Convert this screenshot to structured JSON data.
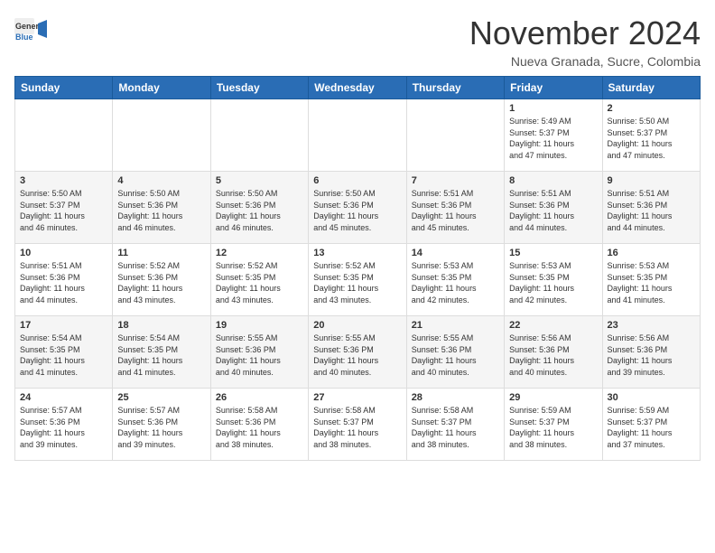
{
  "header": {
    "logo_line1": "General",
    "logo_line2": "Blue",
    "month": "November 2024",
    "location": "Nueva Granada, Sucre, Colombia"
  },
  "weekdays": [
    "Sunday",
    "Monday",
    "Tuesday",
    "Wednesday",
    "Thursday",
    "Friday",
    "Saturday"
  ],
  "weeks": [
    [
      {
        "day": "",
        "info": ""
      },
      {
        "day": "",
        "info": ""
      },
      {
        "day": "",
        "info": ""
      },
      {
        "day": "",
        "info": ""
      },
      {
        "day": "",
        "info": ""
      },
      {
        "day": "1",
        "info": "Sunrise: 5:49 AM\nSunset: 5:37 PM\nDaylight: 11 hours\nand 47 minutes."
      },
      {
        "day": "2",
        "info": "Sunrise: 5:50 AM\nSunset: 5:37 PM\nDaylight: 11 hours\nand 47 minutes."
      }
    ],
    [
      {
        "day": "3",
        "info": "Sunrise: 5:50 AM\nSunset: 5:37 PM\nDaylight: 11 hours\nand 46 minutes."
      },
      {
        "day": "4",
        "info": "Sunrise: 5:50 AM\nSunset: 5:36 PM\nDaylight: 11 hours\nand 46 minutes."
      },
      {
        "day": "5",
        "info": "Sunrise: 5:50 AM\nSunset: 5:36 PM\nDaylight: 11 hours\nand 46 minutes."
      },
      {
        "day": "6",
        "info": "Sunrise: 5:50 AM\nSunset: 5:36 PM\nDaylight: 11 hours\nand 45 minutes."
      },
      {
        "day": "7",
        "info": "Sunrise: 5:51 AM\nSunset: 5:36 PM\nDaylight: 11 hours\nand 45 minutes."
      },
      {
        "day": "8",
        "info": "Sunrise: 5:51 AM\nSunset: 5:36 PM\nDaylight: 11 hours\nand 44 minutes."
      },
      {
        "day": "9",
        "info": "Sunrise: 5:51 AM\nSunset: 5:36 PM\nDaylight: 11 hours\nand 44 minutes."
      }
    ],
    [
      {
        "day": "10",
        "info": "Sunrise: 5:51 AM\nSunset: 5:36 PM\nDaylight: 11 hours\nand 44 minutes."
      },
      {
        "day": "11",
        "info": "Sunrise: 5:52 AM\nSunset: 5:36 PM\nDaylight: 11 hours\nand 43 minutes."
      },
      {
        "day": "12",
        "info": "Sunrise: 5:52 AM\nSunset: 5:35 PM\nDaylight: 11 hours\nand 43 minutes."
      },
      {
        "day": "13",
        "info": "Sunrise: 5:52 AM\nSunset: 5:35 PM\nDaylight: 11 hours\nand 43 minutes."
      },
      {
        "day": "14",
        "info": "Sunrise: 5:53 AM\nSunset: 5:35 PM\nDaylight: 11 hours\nand 42 minutes."
      },
      {
        "day": "15",
        "info": "Sunrise: 5:53 AM\nSunset: 5:35 PM\nDaylight: 11 hours\nand 42 minutes."
      },
      {
        "day": "16",
        "info": "Sunrise: 5:53 AM\nSunset: 5:35 PM\nDaylight: 11 hours\nand 41 minutes."
      }
    ],
    [
      {
        "day": "17",
        "info": "Sunrise: 5:54 AM\nSunset: 5:35 PM\nDaylight: 11 hours\nand 41 minutes."
      },
      {
        "day": "18",
        "info": "Sunrise: 5:54 AM\nSunset: 5:35 PM\nDaylight: 11 hours\nand 41 minutes."
      },
      {
        "day": "19",
        "info": "Sunrise: 5:55 AM\nSunset: 5:36 PM\nDaylight: 11 hours\nand 40 minutes."
      },
      {
        "day": "20",
        "info": "Sunrise: 5:55 AM\nSunset: 5:36 PM\nDaylight: 11 hours\nand 40 minutes."
      },
      {
        "day": "21",
        "info": "Sunrise: 5:55 AM\nSunset: 5:36 PM\nDaylight: 11 hours\nand 40 minutes."
      },
      {
        "day": "22",
        "info": "Sunrise: 5:56 AM\nSunset: 5:36 PM\nDaylight: 11 hours\nand 40 minutes."
      },
      {
        "day": "23",
        "info": "Sunrise: 5:56 AM\nSunset: 5:36 PM\nDaylight: 11 hours\nand 39 minutes."
      }
    ],
    [
      {
        "day": "24",
        "info": "Sunrise: 5:57 AM\nSunset: 5:36 PM\nDaylight: 11 hours\nand 39 minutes."
      },
      {
        "day": "25",
        "info": "Sunrise: 5:57 AM\nSunset: 5:36 PM\nDaylight: 11 hours\nand 39 minutes."
      },
      {
        "day": "26",
        "info": "Sunrise: 5:58 AM\nSunset: 5:36 PM\nDaylight: 11 hours\nand 38 minutes."
      },
      {
        "day": "27",
        "info": "Sunrise: 5:58 AM\nSunset: 5:37 PM\nDaylight: 11 hours\nand 38 minutes."
      },
      {
        "day": "28",
        "info": "Sunrise: 5:58 AM\nSunset: 5:37 PM\nDaylight: 11 hours\nand 38 minutes."
      },
      {
        "day": "29",
        "info": "Sunrise: 5:59 AM\nSunset: 5:37 PM\nDaylight: 11 hours\nand 38 minutes."
      },
      {
        "day": "30",
        "info": "Sunrise: 5:59 AM\nSunset: 5:37 PM\nDaylight: 11 hours\nand 37 minutes."
      }
    ]
  ]
}
